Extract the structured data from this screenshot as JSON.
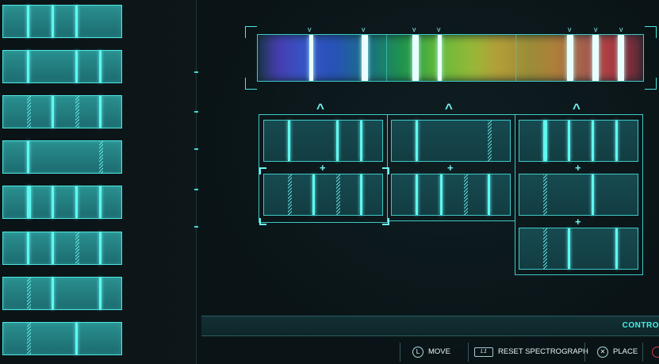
{
  "bottom_bar": {
    "controls_label": "CONTRO",
    "hints": [
      {
        "button": "L",
        "label": "MOVE"
      },
      {
        "button": "L1",
        "label": "RESET SPECTROGRAPH"
      },
      {
        "button": "✕",
        "label": "PLACE"
      }
    ]
  },
  "colors": {
    "accent": "#5ff7f0",
    "panel": "#1c6c70",
    "background": "#0b1417"
  },
  "icons": {
    "column_up": "^",
    "slot_join": "+",
    "peak_marker": "v"
  }
}
